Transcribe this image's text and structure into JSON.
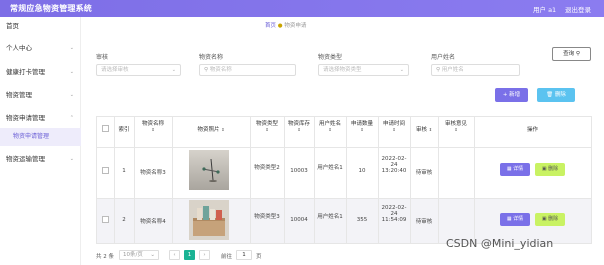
{
  "header": {
    "title": "常规应急物资管理系统",
    "user": "用户 a1",
    "logout": "退出登录"
  },
  "sidebar": {
    "items": [
      {
        "label": "首页"
      },
      {
        "label": "个人中心"
      },
      {
        "label": "健康打卡管理"
      },
      {
        "label": "物资管理"
      },
      {
        "label": "物资申请管理"
      },
      {
        "label": "物资运输管理"
      }
    ],
    "active_sub": "物资申请管理"
  },
  "breadcrumb": {
    "home": "首页",
    "current": "物资申请"
  },
  "search": {
    "fields": [
      {
        "label": "审核",
        "placeholder": "请选择审核"
      },
      {
        "label": "物资名称",
        "placeholder": "物资名称"
      },
      {
        "label": "物资类型",
        "placeholder": "请选择物资类型"
      },
      {
        "label": "用户姓名",
        "placeholder": "用户姓名"
      }
    ],
    "query_label": "查询"
  },
  "actions": {
    "add_label": "新增",
    "delete_label": "删除"
  },
  "table": {
    "headers": [
      "索引",
      "物资名称",
      "物资照片",
      "物资类型",
      "物资库存",
      "用户姓名",
      "申请数量",
      "申请时间",
      "审核",
      "审核意见",
      "操作"
    ],
    "rows": [
      {
        "index": "1",
        "name": "物资名称3",
        "type": "物资类型2",
        "stock": "10003",
        "user": "用户姓名1",
        "qty": "10",
        "time": "2022-02-24 13:20:40",
        "status": "待审核",
        "opinion": "",
        "detail_label": "详情",
        "delete_label": "删除"
      },
      {
        "index": "2",
        "name": "物资名称4",
        "type": "物资类型3",
        "stock": "10004",
        "user": "用户姓名1",
        "qty": "355",
        "time": "2022-02-24 11:54:09",
        "status": "待审核",
        "opinion": "",
        "detail_label": "详情",
        "delete_label": "删除"
      }
    ]
  },
  "pagination": {
    "total": "共 2 条",
    "page_size": "10条/页",
    "current_page": "1",
    "goto_label": "前往",
    "goto_value": "1",
    "page_suffix": "页"
  },
  "watermark": "CSDN @Mini_yidian",
  "colors": {
    "accent": "#7a70e8",
    "cyan": "#5bc3f0",
    "lime": "#c9f263",
    "pager": "#1ab394"
  }
}
